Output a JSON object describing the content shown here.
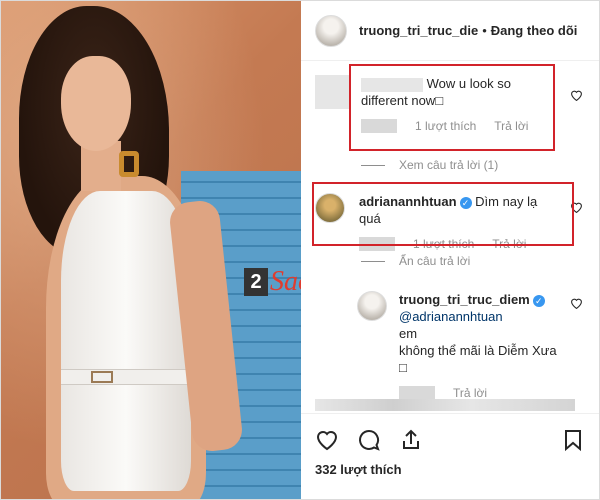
{
  "header": {
    "username": "truong_tri_truc_die",
    "separator": "•",
    "follow_status": "Đang theo dõi"
  },
  "comments": [
    {
      "text": "Wow u look so different now",
      "trailing_glyph": "□",
      "likes": "1 lượt thích",
      "reply": "Trả lời",
      "toggle": "Xem câu trả lời (1)"
    },
    {
      "username": "adrianannhtuan",
      "text": "Dìm nay lạ quá",
      "likes": "1 lượt thích",
      "reply": "Trả lời",
      "toggle": "Ẩn câu trả lời"
    },
    {
      "username": "truong_tri_truc_diem",
      "mention": "@adrianannhtuan",
      "text_line1": "em",
      "text_line2": "không thể mãi là Diễm Xưa",
      "trailing_glyph": "□",
      "reply": "Trả lời"
    }
  ],
  "actions": {
    "likes_count": "332 lượt thích"
  },
  "watermark": {
    "number": "2",
    "text": "Sao"
  },
  "colors": {
    "highlight": "#d2232a",
    "verified": "#3897f0",
    "link": "#003569",
    "muted": "#8e8e8e"
  },
  "icons": [
    "heart-icon",
    "comment-icon",
    "share-icon",
    "bookmark-icon",
    "verified-badge-icon"
  ]
}
